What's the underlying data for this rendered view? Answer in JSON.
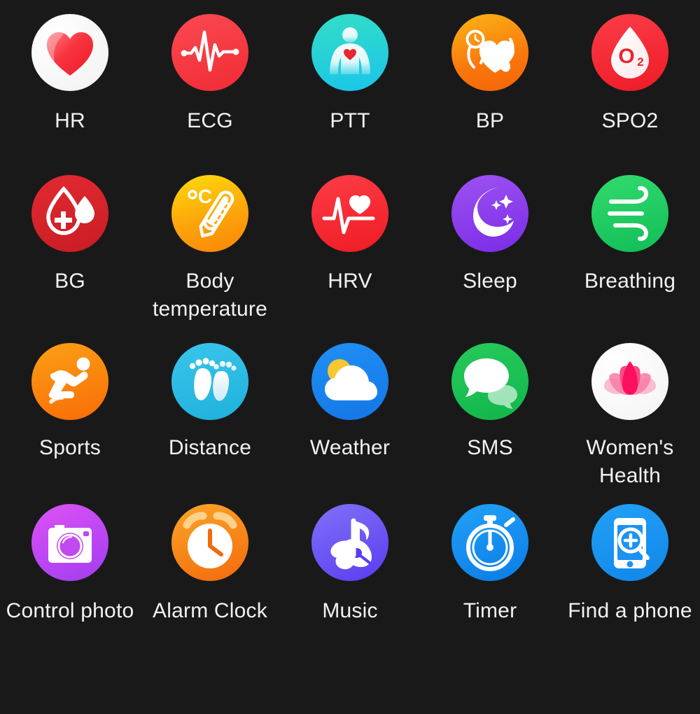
{
  "screen": {
    "title": "Smartwatch Feature Icon Grid",
    "background_color": "#191919",
    "label_color": "#f2f2f2",
    "columns": 5,
    "rows": 4
  },
  "items": [
    {
      "label": "HR",
      "icon": "heart-icon",
      "circle_colors": [
        "#ffffff",
        "#f3f3f3"
      ],
      "accent": "#f5333f",
      "row": 1,
      "col": 1
    },
    {
      "label": "ECG",
      "icon": "ecg-wave-icon",
      "circle_colors": [
        "#f9434b",
        "#ef2d36"
      ],
      "accent": "#ffffff",
      "row": 1,
      "col": 2
    },
    {
      "label": "PTT",
      "icon": "body-torso-icon",
      "circle_colors": [
        "#2fd9c8",
        "#17c2e8"
      ],
      "accent": "#ffffff",
      "row": 1,
      "col": 3
    },
    {
      "label": "BP",
      "icon": "blood-pressure-icon",
      "circle_colors": [
        "#fbb016",
        "#f96b0b"
      ],
      "accent": "#ffffff",
      "row": 1,
      "col": 4
    },
    {
      "label": "SPO2",
      "icon": "oxygen-drop-icon",
      "circle_colors": [
        "#fa3a45",
        "#ee1b27"
      ],
      "accent": "#ffffff",
      "row": 1,
      "col": 5
    },
    {
      "label": "BG",
      "icon": "blood-glucose-icon",
      "circle_colors": [
        "#e0272f",
        "#cf2026"
      ],
      "accent": "#ffffff",
      "row": 2,
      "col": 1
    },
    {
      "label": "Body temperature",
      "icon": "thermometer-icon",
      "circle_colors": [
        "#ffd90a",
        "#fb8c08"
      ],
      "accent": "#ffffff",
      "row": 2,
      "col": 2
    },
    {
      "label": "HRV",
      "icon": "heart-rate-variability-icon",
      "circle_colors": [
        "#fb3640",
        "#f01e28"
      ],
      "accent": "#ffffff",
      "row": 2,
      "col": 3
    },
    {
      "label": "Sleep",
      "icon": "moon-stars-icon",
      "circle_colors": [
        "#9a4ff0",
        "#7b2ee8"
      ],
      "accent": "#ffffff",
      "row": 2,
      "col": 4
    },
    {
      "label": "Breathing",
      "icon": "wind-breathing-icon",
      "circle_colors": [
        "#2fd96a",
        "#13c05a"
      ],
      "accent": "#ffffff",
      "row": 2,
      "col": 5
    },
    {
      "label": "Sports",
      "icon": "runner-icon",
      "circle_colors": [
        "#fb9c14",
        "#f96a07"
      ],
      "accent": "#ffffff",
      "row": 3,
      "col": 1
    },
    {
      "label": "Distance",
      "icon": "footprints-icon",
      "circle_colors": [
        "#36c2e8",
        "#21b4dd"
      ],
      "accent": "#ffffff",
      "row": 3,
      "col": 2
    },
    {
      "label": "Weather",
      "icon": "sun-cloud-icon",
      "circle_colors": [
        "#1f8bf2",
        "#1478e8"
      ],
      "accent": "#ffffff",
      "row": 3,
      "col": 3
    },
    {
      "label": "SMS",
      "icon": "chat-bubbles-icon",
      "circle_colors": [
        "#24c75a",
        "#12b84c"
      ],
      "accent": "#ffffff",
      "row": 3,
      "col": 4
    },
    {
      "label": "Women's Health",
      "icon": "lotus-flower-icon",
      "circle_colors": [
        "#ffffff",
        "#f5f5f5"
      ],
      "accent": "#fa1f63",
      "row": 3,
      "col": 5
    },
    {
      "label": "Control photo",
      "icon": "camera-icon",
      "circle_colors": [
        "#d84ff5",
        "#a13df0"
      ],
      "accent": "#ffffff",
      "row": 4,
      "col": 1
    },
    {
      "label": "Alarm Clock",
      "icon": "alarm-clock-icon",
      "circle_colors": [
        "#f9a126",
        "#f4690c"
      ],
      "accent": "#ffffff",
      "row": 4,
      "col": 2
    },
    {
      "label": "Music",
      "icon": "music-note-disc-icon",
      "circle_colors": [
        "#7b6ef6",
        "#5b3df0"
      ],
      "accent": "#ffffff",
      "row": 4,
      "col": 3
    },
    {
      "label": "Timer",
      "icon": "stopwatch-icon",
      "circle_colors": [
        "#1e9cf5",
        "#0b7fe8"
      ],
      "accent": "#ffffff",
      "row": 4,
      "col": 4
    },
    {
      "label": "Find a phone",
      "icon": "phone-search-icon",
      "circle_colors": [
        "#1f9cf0",
        "#1289ea"
      ],
      "accent": "#ffffff",
      "row": 4,
      "col": 5
    }
  ]
}
